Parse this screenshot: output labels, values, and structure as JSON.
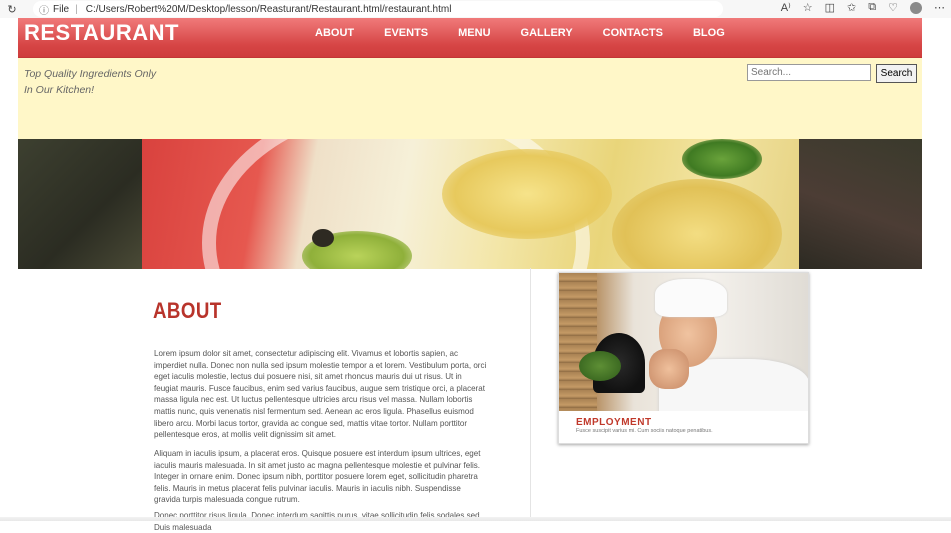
{
  "browser": {
    "refresh_icon": "refresh-icon",
    "address_scheme": "File",
    "address_url": "C:/Users/Robert%20M/Desktop/lesson/Reasturant/Restaurant.html/restaurant.html",
    "right_icons": [
      "read-aloud-icon",
      "favorite-star-icon",
      "split-screen-icon",
      "favorites-icon",
      "collections-icon",
      "browser-essentials-icon",
      "profile-avatar",
      "more-icon"
    ]
  },
  "header": {
    "logo": "RESTAURANT",
    "nav": [
      "ABOUT",
      "EVENTS",
      "MENU",
      "GALLERY",
      "CONTACTS",
      "BLOG"
    ],
    "colors": {
      "header_red": "#d64545",
      "tagbar_yellow": "#fff7c8"
    }
  },
  "tagline": {
    "line1": "Top Quality Ingredients Only",
    "line2": "In Our Kitchen!"
  },
  "search": {
    "placeholder": "Search...",
    "button_label": "Search"
  },
  "about": {
    "heading": "ABOUT",
    "paragraphs": [
      "Lorem ipsum dolor sit amet, consectetur adipiscing elit. Vivamus et lobortis sapien, ac imperdiet nulla. Donec non nulla sed ipsum molestie tempor a et lorem. Vestibulum porta, orci eget iaculis molestie, lectus dui posuere nisi, sit amet rhoncus mauris dui ut risus. Ut in feugiat mauris. Fusce faucibus, enim sed varius faucibus, augue sem tristique orci, a placerat massa ligula nec est. Ut luctus pellentesque ultricies arcu risus vel massa. Nullam lobortis mattis nunc, quis venenatis nisl fermentum sed. Aenean ac eros ligula. Phasellus euismod libero arcu. Morbi lacus tortor, gravida ac congue sed, mattis vitae tortor. Nullam porttitor pellentesque eros, at mollis velit dignissim sit amet.",
      "Aliquam in iaculis ipsum, a placerat eros. Quisque posuere est interdum ipsum ultrices, eget iaculis mauris malesuada. In sit amet justo ac magna pellentesque molestie et pulvinar felis. Integer in ornare enim. Donec ipsum nibh, porttitor posuere lorem eget, sollicitudin pharetra felis. Mauris in metus placerat felis pulvinar iaculis. Mauris in iaculis nibh. Suspendisse gravida turpis malesuada congue rutrum.",
      "Donec porttitor risus ligula. Donec interdum sagittis purus, vitae sollicitudin felis sodales sed. Duis malesuada"
    ]
  },
  "employment": {
    "title": "EMPLOYMENT",
    "subtitle": "Fusce suscipit varius mi. Cum sociis natoque penatibus."
  }
}
